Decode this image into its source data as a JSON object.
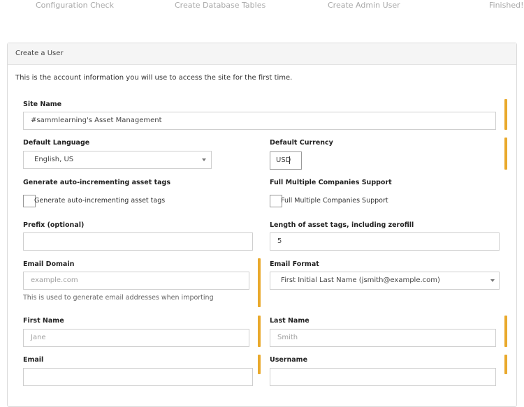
{
  "steps": [
    "Configuration Check",
    "Create Database Tables",
    "Create Admin User",
    "Finished!"
  ],
  "panel": {
    "title": "Create a User",
    "intro": "This is the account information you will use to access the site for the first time."
  },
  "form": {
    "site_name": {
      "label": "Site Name",
      "value": "#sammlearning's Asset Management"
    },
    "default_language": {
      "label": "Default Language",
      "value": "English, US"
    },
    "default_currency": {
      "label": "Default Currency",
      "value": "USD"
    },
    "auto_increment": {
      "label": "Generate auto-incrementing asset tags",
      "checkbox_label": "Generate auto-incrementing asset tags"
    },
    "multi_company": {
      "label": "Full Multiple Companies Support",
      "checkbox_label": "Full Multiple Companies Support"
    },
    "prefix": {
      "label": "Prefix (optional)",
      "value": ""
    },
    "tag_length": {
      "label": "Length of asset tags, including zerofill",
      "value": "5"
    },
    "email_domain": {
      "label": "Email Domain",
      "placeholder": "example.com",
      "help": "This is used to generate email addresses when importing"
    },
    "email_format": {
      "label": "Email Format",
      "value": "First Initial Last Name (jsmith@example.com)"
    },
    "first_name": {
      "label": "First Name",
      "placeholder": "Jane"
    },
    "last_name": {
      "label": "Last Name",
      "placeholder": "Smith"
    },
    "email": {
      "label": "Email"
    },
    "username": {
      "label": "Username"
    }
  },
  "colors": {
    "required_bar": "#e9a92c",
    "header_bg": "#f5f5f5"
  }
}
